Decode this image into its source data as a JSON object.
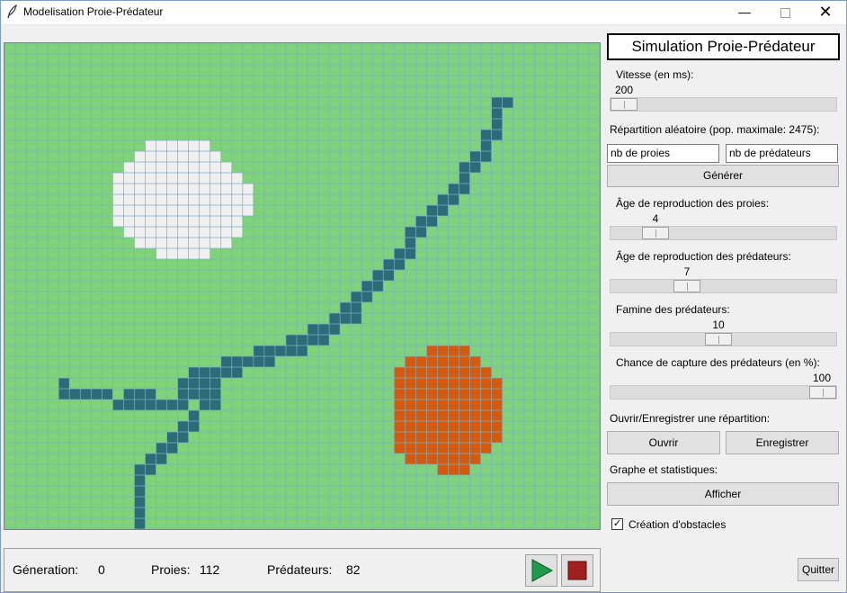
{
  "window": {
    "title": "Modelisation Proie-Prédateur",
    "minimize_icon": "minimize-icon",
    "maximize_icon": "maximize-icon",
    "close_icon": "close-icon"
  },
  "colors": {
    "grass": "#7fd17a",
    "grid_line": "#78b0c8",
    "prey": "#f0f0f0",
    "predator": "#d65a0a",
    "obstacle": "#2e6b78"
  },
  "status": {
    "generation_label": "Géneration:",
    "generation_value": "0",
    "prey_label": "Proies:",
    "prey_value": "112",
    "predator_label": "Prédateurs:",
    "predator_value": "82",
    "play_icon": "play-icon",
    "stop_icon": "stop-icon"
  },
  "panel": {
    "title": "Simulation Proie-Prédateur",
    "speed_label": "Vitesse (en ms):",
    "speed_value": "200",
    "random_label": "Répartition aléatoire (pop. maximale: 2475):",
    "prey_count_field": "nb de proies",
    "predator_count_field": "nb de prédateurs",
    "generate_button": "Générer",
    "prey_repro_label": "Âge de reproduction des proies:",
    "prey_repro_value": "4",
    "pred_repro_label": "Âge de reproduction des prédateurs:",
    "pred_repro_value": "7",
    "famine_label": "Famine des prédateurs:",
    "famine_value": "10",
    "capture_label": "Chance de capture des prédateurs (en %):",
    "capture_value": "100",
    "file_label": "Ouvrir/Enregistrer une répartition:",
    "open_button": "Ouvrir",
    "save_button": "Enregistrer",
    "graph_label": "Graphe et statistiques:",
    "show_button": "Afficher",
    "obstacles_label": "Création d'obstacles",
    "obstacles_checked": true,
    "quit_button": "Quitter"
  },
  "grid": {
    "cols": 55,
    "rows": 45,
    "prey_rows": [
      [
        9,
        13,
        18
      ],
      [
        10,
        12,
        19
      ],
      [
        11,
        11,
        20
      ],
      [
        12,
        10,
        21
      ],
      [
        13,
        10,
        22
      ],
      [
        14,
        10,
        22
      ],
      [
        15,
        10,
        22
      ],
      [
        16,
        10,
        21
      ],
      [
        17,
        11,
        21
      ],
      [
        18,
        12,
        20
      ],
      [
        19,
        14,
        18
      ]
    ],
    "predator_rows": [
      [
        28,
        39,
        42
      ],
      [
        29,
        37,
        43
      ],
      [
        30,
        36,
        44
      ],
      [
        31,
        36,
        45
      ],
      [
        32,
        36,
        45
      ],
      [
        33,
        36,
        45
      ],
      [
        34,
        36,
        45
      ],
      [
        35,
        36,
        45
      ],
      [
        36,
        36,
        45
      ],
      [
        37,
        36,
        44
      ],
      [
        38,
        37,
        43
      ],
      [
        39,
        40,
        42
      ]
    ],
    "obstacle_segments": [
      [
        5,
        45,
        46
      ],
      [
        6,
        45,
        45
      ],
      [
        7,
        45,
        45
      ],
      [
        8,
        44,
        45
      ],
      [
        9,
        44,
        44
      ],
      [
        10,
        43,
        44
      ],
      [
        11,
        42,
        43
      ],
      [
        12,
        42,
        42
      ],
      [
        13,
        41,
        42
      ],
      [
        14,
        40,
        41
      ],
      [
        15,
        39,
        40
      ],
      [
        16,
        38,
        39
      ],
      [
        17,
        37,
        38
      ],
      [
        18,
        37,
        37
      ],
      [
        19,
        36,
        37
      ],
      [
        20,
        35,
        36
      ],
      [
        21,
        34,
        35
      ],
      [
        22,
        33,
        34
      ],
      [
        23,
        32,
        33
      ],
      [
        24,
        31,
        32
      ],
      [
        25,
        30,
        32
      ],
      [
        26,
        28,
        30
      ],
      [
        27,
        26,
        29
      ],
      [
        28,
        23,
        27
      ],
      [
        29,
        20,
        24
      ],
      [
        30,
        17,
        21
      ],
      [
        31,
        16,
        19
      ],
      [
        31,
        5,
        5
      ],
      [
        32,
        5,
        9
      ],
      [
        32,
        16,
        19
      ],
      [
        32,
        11,
        13
      ],
      [
        33,
        10,
        16
      ],
      [
        33,
        18,
        19
      ],
      [
        34,
        17,
        17
      ],
      [
        35,
        16,
        17
      ],
      [
        36,
        15,
        16
      ],
      [
        37,
        14,
        15
      ],
      [
        38,
        13,
        14
      ],
      [
        39,
        12,
        13
      ],
      [
        40,
        12,
        12
      ],
      [
        41,
        12,
        12
      ],
      [
        42,
        12,
        12
      ],
      [
        43,
        12,
        12
      ],
      [
        44,
        12,
        12
      ]
    ]
  }
}
